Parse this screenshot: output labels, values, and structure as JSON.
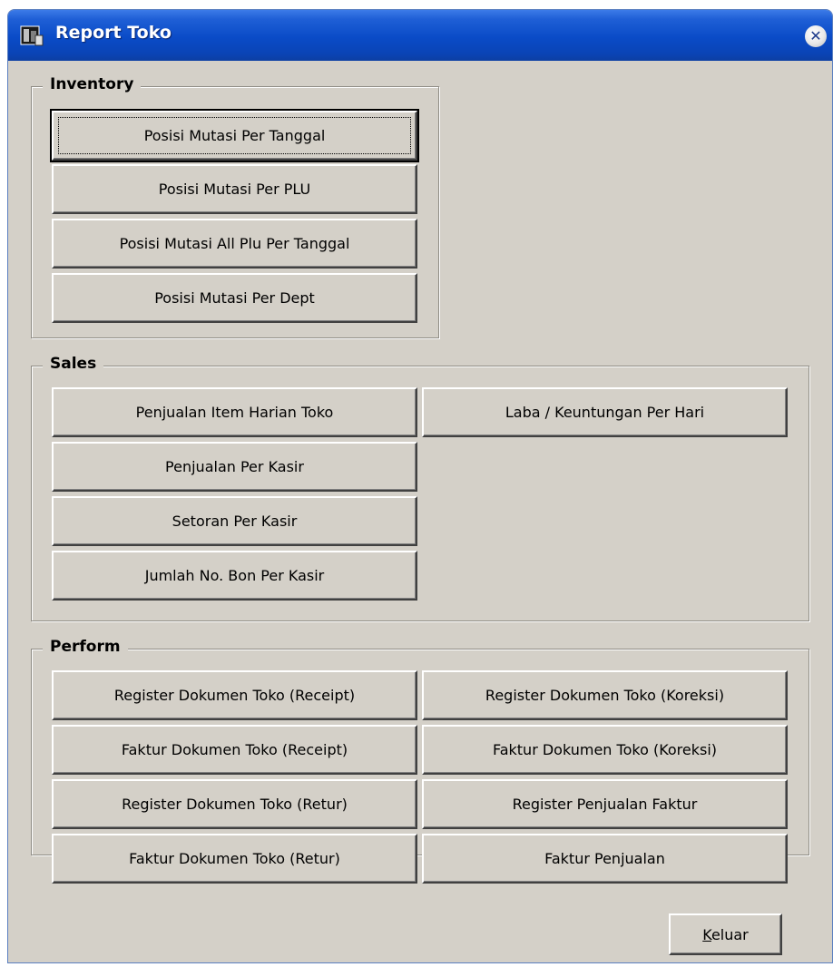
{
  "window": {
    "title": "Report Toko",
    "close_glyph": "✕"
  },
  "inventory": {
    "legend": "Inventory",
    "buttons": [
      "Posisi Mutasi Per Tanggal",
      "Posisi Mutasi Per PLU",
      "Posisi Mutasi All Plu Per Tanggal",
      "Posisi Mutasi Per Dept"
    ]
  },
  "sales": {
    "legend": "Sales",
    "left_buttons": [
      "Penjualan Item Harian Toko",
      "Penjualan Per Kasir",
      "Setoran Per Kasir",
      "Jumlah No. Bon Per Kasir"
    ],
    "right_buttons": [
      "Laba / Keuntungan Per Hari"
    ]
  },
  "perform": {
    "legend": "Perform",
    "left_buttons": [
      "Register Dokumen Toko (Receipt)",
      "Faktur Dokumen Toko (Receipt)",
      "Register Dokumen Toko (Retur)",
      "Faktur Dokumen Toko (Retur)"
    ],
    "right_buttons": [
      "Register Dokumen Toko (Koreksi)",
      "Faktur Dokumen Toko (Koreksi)",
      "Register Penjualan Faktur",
      "Faktur Penjualan"
    ]
  },
  "footer": {
    "exit_mnemonic": "K",
    "exit_rest": "eluar"
  },
  "icons": {
    "app": "report-app-icon",
    "close": "close-icon"
  },
  "colors": {
    "titlebar": "#0a4bc7",
    "face": "#d4d0c8"
  }
}
